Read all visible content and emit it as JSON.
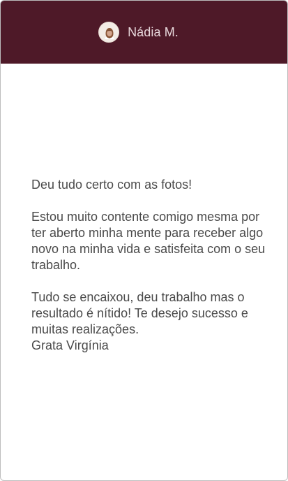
{
  "header": {
    "author_name": "Nádia M.",
    "background_color": "#4e1928",
    "avatar_icon": "person-avatar-icon"
  },
  "message": {
    "paragraphs": [
      {
        "lines": [
          "Deu tudo certo com as fotos!"
        ]
      },
      {
        "lines": [
          "Estou muito contente comigo mesma por",
          "ter aberto minha mente para receber algo",
          "novo na minha vida e satisfeita com o seu",
          "trabalho."
        ]
      },
      {
        "lines": [
          "Tudo se encaixou, deu trabalho mas o",
          "resultado é nítido! Te desejo sucesso e",
          "muitas realizações.",
          "Grata Virgínia"
        ]
      }
    ]
  }
}
